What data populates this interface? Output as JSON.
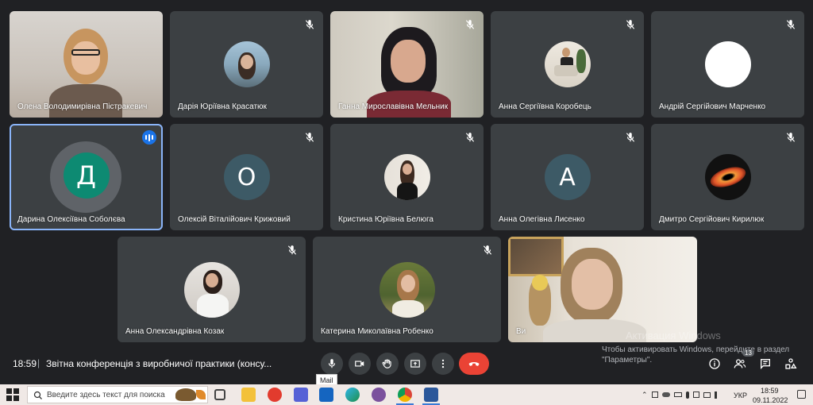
{
  "participants": [
    {
      "name": "Олена Володимирівна Пістракевич"
    },
    {
      "name": "Дарія Юріївна Красатюк"
    },
    {
      "name": "Ганна Мирославівна Мельник"
    },
    {
      "name": "Анна Сергіївна Коробець"
    },
    {
      "name": "Андрій Сергійович Марченко"
    },
    {
      "name": "Дарина Олексіївна Соболєва",
      "initial": "Д"
    },
    {
      "name": "Олексій Віталійович Крижовий",
      "initial": "О"
    },
    {
      "name": "Кристина Юріївна Белюга"
    },
    {
      "name": "Анна Олегівна Лисенко",
      "initial": "А"
    },
    {
      "name": "Дмитро Сергійович Кирилюк"
    },
    {
      "name": "Анна Олександрівна Козак"
    },
    {
      "name": "Катерина Миколаївна Робенко"
    },
    {
      "name": "Ви"
    }
  ],
  "bottom_bar": {
    "time": "18:59",
    "separator": "|",
    "meeting_title": "Звітна конференція з виробничої практики (консу...",
    "participants_count": "13"
  },
  "activation": {
    "watermark": "Активация Windows",
    "line1": "Чтобы активировать Windows, перейдите в раздел",
    "line2": "\"Параметры\"."
  },
  "tooltip": "Mail",
  "taskbar": {
    "search_placeholder": "Введите здесь текст для поиска",
    "lang": "УКР",
    "time": "18:59",
    "date": "09.11.2022"
  },
  "colors": {
    "tile": "#3c4043",
    "background": "#202124",
    "speaking_outline": "#8ab4f8",
    "end_call": "#ea4335",
    "avatar_green": "#0d8a72",
    "avatar_slate": "#3d5a66"
  },
  "icons": [
    "mic-off-icon",
    "mic-icon",
    "camera-icon",
    "raise-hand-icon",
    "present-icon",
    "more-icon",
    "end-call-icon",
    "info-icon",
    "people-icon",
    "chat-icon",
    "activities-icon",
    "windows-start-icon",
    "search-icon"
  ]
}
